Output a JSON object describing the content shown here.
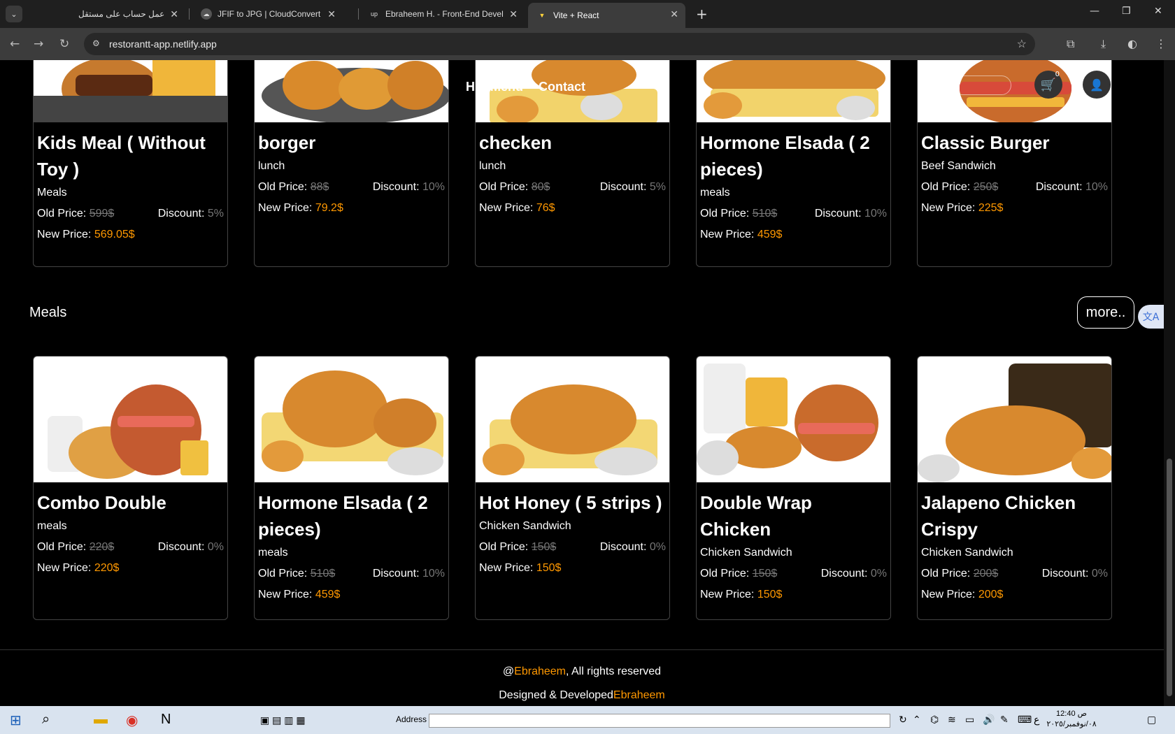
{
  "browser": {
    "tabs": [
      {
        "title": "عمل حساب على مستقل",
        "active": false
      },
      {
        "title": "JFIF to JPG | CloudConvert",
        "active": false
      },
      {
        "title": "Ebraheem H. - Front-End Devel",
        "active": false
      },
      {
        "title": "Vite + React",
        "active": true
      }
    ],
    "url": "restorantt-app.netlify.app"
  },
  "site_nav": {
    "links": [
      "H",
      "Menu",
      "Contact"
    ],
    "cart_count": "0"
  },
  "top_cards": [
    {
      "title": "Kids Meal ( Without Toy )",
      "category": "Meals",
      "old_label": "Old Price:",
      "old_price": "599$",
      "discount_label": "Discount:",
      "discount": "5%",
      "new_label": "New Price:",
      "new_price": "569.05$"
    },
    {
      "title": "borger",
      "category": "lunch",
      "old_label": "Old Price:",
      "old_price": "88$",
      "discount_label": "Discount:",
      "discount": "10%",
      "new_label": "New Price:",
      "new_price": "79.2$"
    },
    {
      "title": "checken",
      "category": "lunch",
      "old_label": "Old Price:",
      "old_price": "80$",
      "discount_label": "Discount:",
      "discount": "5%",
      "new_label": "New Price:",
      "new_price": "76$"
    },
    {
      "title": "Hormone Elsada ( 2 pieces)",
      "category": "meals",
      "old_label": "Old Price:",
      "old_price": "510$",
      "discount_label": "Discount:",
      "discount": "10%",
      "new_label": "New Price:",
      "new_price": "459$"
    },
    {
      "title": "Classic Burger",
      "category": "Beef Sandwich",
      "old_label": "Old Price:",
      "old_price": "250$",
      "discount_label": "Discount:",
      "discount": "10%",
      "new_label": "New Price:",
      "new_price": "225$"
    }
  ],
  "section": {
    "title": "Meals",
    "more_label": "more.."
  },
  "meal_cards": [
    {
      "title": "Combo Double",
      "category": "meals",
      "old_label": "Old Price:",
      "old_price": "220$",
      "discount_label": "Discount:",
      "discount": "0%",
      "new_label": "New Price:",
      "new_price": "220$"
    },
    {
      "title": "Hormone Elsada ( 2 pieces)",
      "category": "meals",
      "old_label": "Old Price:",
      "old_price": "510$",
      "discount_label": "Discount:",
      "discount": "10%",
      "new_label": "New Price:",
      "new_price": "459$"
    },
    {
      "title": "Hot Honey ( 5 strips )",
      "category": "Chicken Sandwich",
      "old_label": "Old Price:",
      "old_price": "150$",
      "discount_label": "Discount:",
      "discount": "0%",
      "new_label": "New Price:",
      "new_price": "150$"
    },
    {
      "title": "Double Wrap Chicken",
      "category": "Chicken Sandwich",
      "old_label": "Old Price:",
      "old_price": "150$",
      "discount_label": "Discount:",
      "discount": "0%",
      "new_label": "New Price:",
      "new_price": "150$"
    },
    {
      "title": "Jalapeno Chicken Crispy",
      "category": "Chicken Sandwich",
      "old_label": "Old Price:",
      "old_price": "200$",
      "discount_label": "Discount:",
      "discount": "0%",
      "new_label": "New Price:",
      "new_price": "200$"
    }
  ],
  "footer": {
    "at": "@",
    "author": "Ebraheem",
    "rights": ", All rights reserved",
    "designed": "Designed & Developed",
    "author2": "Ebraheem"
  },
  "taskbar": {
    "address_label": "Address",
    "lang": "ع",
    "time": "12:40 ص",
    "date": "٠٨/نوفمبر/٢٠٢٥"
  },
  "colors": {
    "accent": "#ff9800",
    "page_bg": "#000000"
  }
}
